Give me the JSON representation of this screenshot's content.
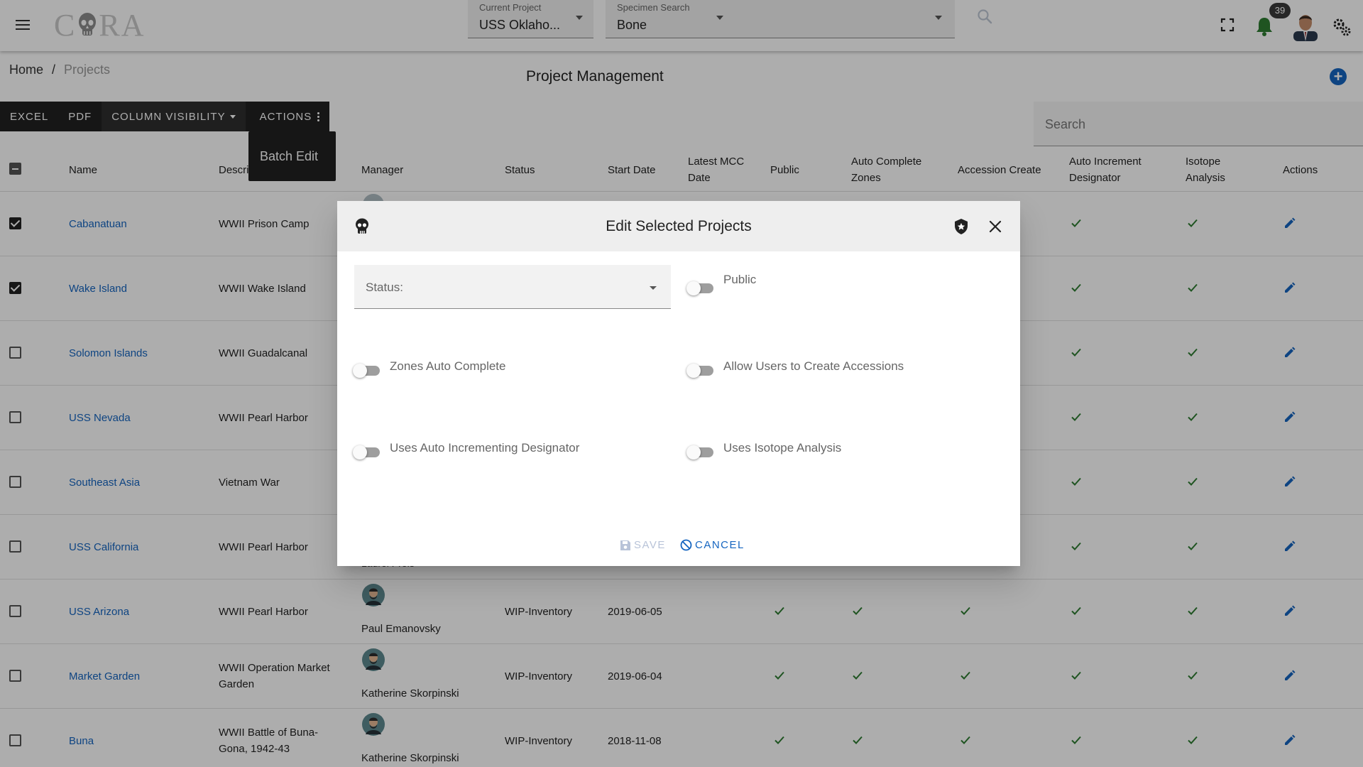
{
  "topbar": {
    "logo_text": "CORA",
    "current_project": {
      "label": "Current Project",
      "value": "USS Oklaho..."
    },
    "specimen_search": {
      "label": "Specimen Search",
      "value": "Bone"
    },
    "notifications_count": "39",
    "accent_color": "#1565c0",
    "bell_color": "#2e7d32"
  },
  "breadcrumb": {
    "home": "Home",
    "separator": "/",
    "current": "Projects"
  },
  "page_title": "Project Management",
  "toolbar": {
    "excel": "EXCEL",
    "pdf": "PDF",
    "column_visibility": "COLUMN VISIBILITY",
    "actions": "ACTIONS",
    "batch_edit": "Batch Edit"
  },
  "table_search": {
    "placeholder": "Search"
  },
  "table": {
    "headers": {
      "name": "Name",
      "description": "Descri",
      "manager": "Manager",
      "status": "Status",
      "start_date": "Start Date",
      "latest_mcc_date": [
        "Latest MCC",
        "Date"
      ],
      "public": "Public",
      "auto_complete_zones": [
        "Auto Complete",
        "Zones"
      ],
      "accession_create": "Accession Create",
      "auto_increment_designator": [
        "Auto Increment",
        "Designator"
      ],
      "isotope_analysis": [
        "Isotope",
        "Analysis"
      ],
      "actions": "Actions"
    },
    "rows": [
      {
        "checked": true,
        "name": "Cabanatuan",
        "description": [
          "WWII Prison Camp"
        ]
      },
      {
        "checked": true,
        "name": "Wake Island",
        "description": [
          "WWII Wake Island"
        ]
      },
      {
        "checked": false,
        "name": "Solomon Islands",
        "description": [
          "WWII Guadalcanal"
        ]
      },
      {
        "checked": false,
        "name": "USS Nevada",
        "description": [
          "WWII Pearl Harbor"
        ]
      },
      {
        "checked": false,
        "name": "Southeast Asia",
        "description": [
          "Vietnam War"
        ]
      },
      {
        "checked": false,
        "name": "USS California",
        "description": [
          "WWII Pearl Harbor"
        ],
        "manager_partial": "Laurel Preis"
      },
      {
        "checked": false,
        "name": "USS Arizona",
        "description": [
          "WWII Pearl Harbor"
        ],
        "manager": "Paul Emanovsky",
        "status": "WIP-Inventory",
        "start_date": "2019-06-05"
      },
      {
        "checked": false,
        "name": "Market Garden",
        "description": [
          "WWII Operation Market",
          "Garden"
        ],
        "manager": "Katherine Skorpinski",
        "status": "WIP-Inventory",
        "start_date": "2019-06-04"
      },
      {
        "checked": false,
        "name": "Buna",
        "description": [
          "WWII Battle of Buna-",
          "Gona, 1942-43"
        ],
        "manager": "Katherine Skorpinski",
        "status": "WIP-Inventory",
        "start_date": "2018-11-08"
      }
    ],
    "check_color": "#2e7d32"
  },
  "dialog": {
    "title": "Edit Selected Projects",
    "status_label": "Status:",
    "toggles": {
      "public": "Public",
      "zones_auto_complete": "Zones Auto Complete",
      "allow_create_accessions": "Allow Users to Create Accessions",
      "auto_incrementing_designator": "Uses Auto Incrementing Designator",
      "isotope_analysis": "Uses Isotope Analysis"
    },
    "save": "SAVE",
    "cancel": "CANCEL"
  }
}
